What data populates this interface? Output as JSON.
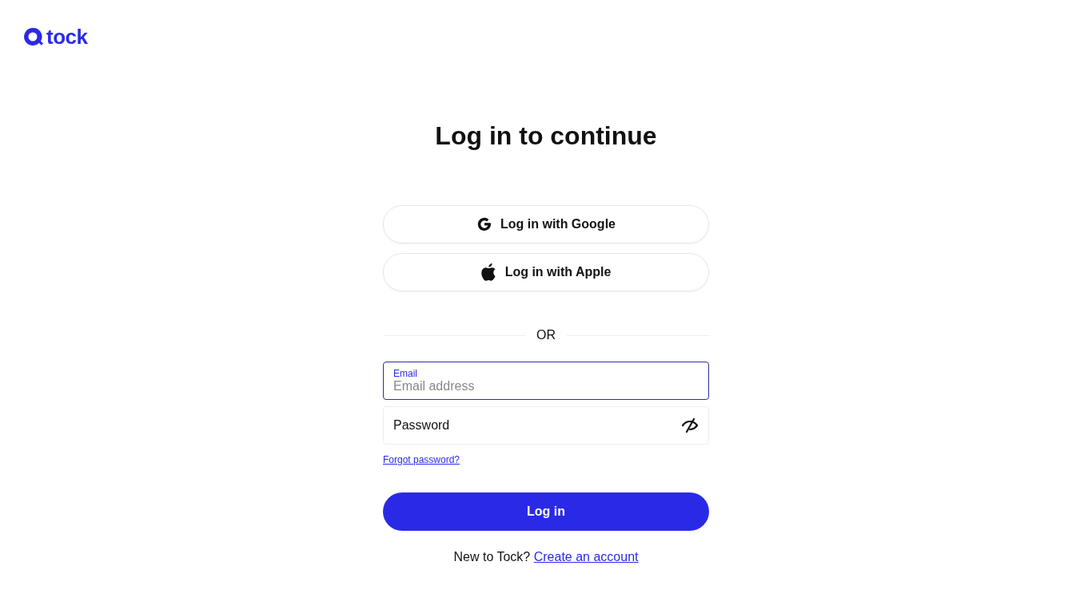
{
  "logo": {
    "text": "tock"
  },
  "title": "Log in to continue",
  "social_buttons": [
    {
      "kind": "google",
      "label": "Log in with Google"
    },
    {
      "kind": "apple",
      "label": "Log in with Apple"
    }
  ],
  "divider": "OR",
  "fields": [
    {
      "kind": "email",
      "label": "Email",
      "placeholder": "Email address",
      "focused": true
    },
    {
      "kind": "password",
      "placeholder": "Password",
      "focused": false
    }
  ],
  "forgot_link": "Forgot password?",
  "submit": "Log in",
  "signup": {
    "text": "New to Tock?",
    "link": "Create an account"
  }
}
